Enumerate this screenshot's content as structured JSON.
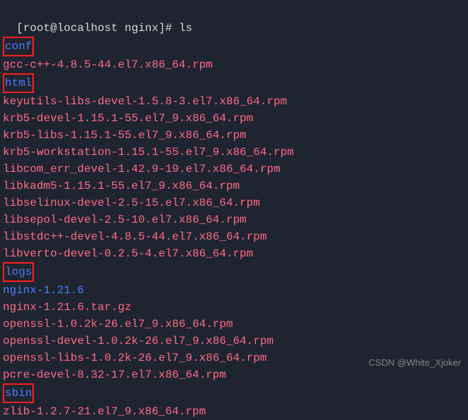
{
  "prompt": {
    "user": "root",
    "host": "localhost",
    "cwd": "nginx",
    "symbol": "#",
    "command": "ls"
  },
  "listing": [
    {
      "name": "conf",
      "type": "dir",
      "boxed": true
    },
    {
      "name": "gcc-c++-4.8.5-44.el7.x86_64.rpm",
      "type": "rpm"
    },
    {
      "name": "html",
      "type": "dir",
      "boxed": true
    },
    {
      "name": "keyutils-libs-devel-1.5.8-3.el7.x86_64.rpm",
      "type": "rpm"
    },
    {
      "name": "krb5-devel-1.15.1-55.el7_9.x86_64.rpm",
      "type": "rpm"
    },
    {
      "name": "krb5-libs-1.15.1-55.el7_9.x86_64.rpm",
      "type": "rpm"
    },
    {
      "name": "krb5-workstation-1.15.1-55.el7_9.x86_64.rpm",
      "type": "rpm"
    },
    {
      "name": "libcom_err_devel-1.42.9-19.el7.x86_64.rpm",
      "type": "rpm"
    },
    {
      "name": "libkadm5-1.15.1-55.el7_9.x86_64.rpm",
      "type": "rpm"
    },
    {
      "name": "libselinux-devel-2.5-15.el7.x86_64.rpm",
      "type": "rpm"
    },
    {
      "name": "libsepol-devel-2.5-10.el7.x86_64.rpm",
      "type": "rpm"
    },
    {
      "name": "libstdc++-devel-4.8.5-44.el7.x86_64.rpm",
      "type": "rpm"
    },
    {
      "name": "libverto-devel-0.2.5-4.el7.x86_64.rpm",
      "type": "rpm"
    },
    {
      "name": "logs",
      "type": "dir",
      "boxed": true
    },
    {
      "name": "nginx-1.21.6",
      "type": "dir",
      "boxed": false
    },
    {
      "name": "nginx-1.21.6.tar.gz",
      "type": "archive"
    },
    {
      "name": "openssl-1.0.2k-26.el7_9.x86_64.rpm",
      "type": "rpm"
    },
    {
      "name": "openssl-devel-1.0.2k-26.el7_9.x86_64.rpm",
      "type": "rpm"
    },
    {
      "name": "openssl-libs-1.0.2k-26.el7_9.x86_64.rpm",
      "type": "rpm"
    },
    {
      "name": "pcre-devel-8.32-17.el7.x86_64.rpm",
      "type": "rpm"
    },
    {
      "name": "sbin",
      "type": "dir",
      "boxed": true
    },
    {
      "name": "zlib-1.2.7-21.el7_9.x86_64.rpm",
      "type": "rpm"
    }
  ],
  "watermark": "CSDN @White_Xjoker"
}
